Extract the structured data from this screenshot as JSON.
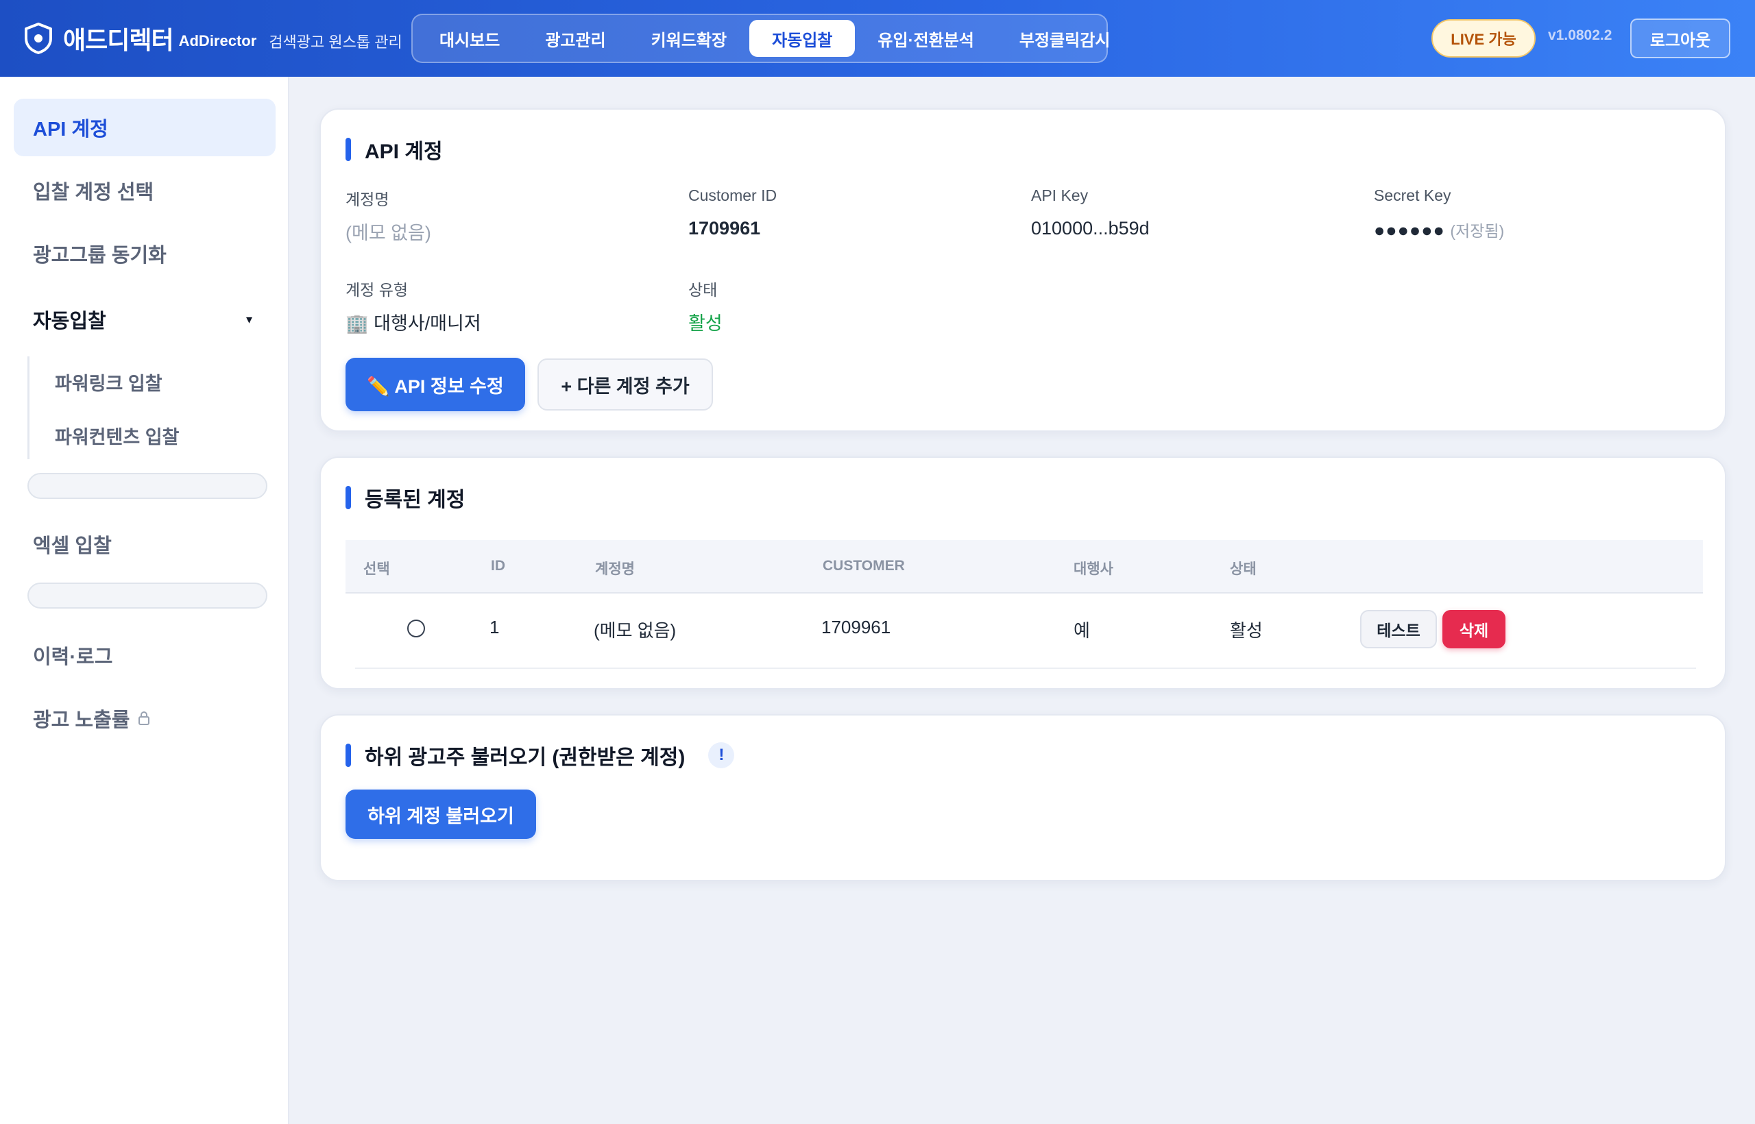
{
  "header": {
    "brand_kr": "애드디렉터",
    "brand_en": "AdDirector",
    "brand_sub": "검색광고 원스톱 관리",
    "tabs": [
      {
        "label": "대시보드",
        "active": false
      },
      {
        "label": "광고관리",
        "active": false
      },
      {
        "label": "키워드확장",
        "active": false
      },
      {
        "label": "자동입찰",
        "active": true
      },
      {
        "label": "유입·전환분석",
        "active": false
      },
      {
        "label": "부정클릭감시",
        "active": false
      }
    ],
    "live_badge": "LIVE 가능",
    "version": "v1.0802.2",
    "logout_label": "로그아웃"
  },
  "sidebar": {
    "api_account": "API 계정",
    "bid_account_select": "입찰 계정 선택",
    "adgroup_sync": "광고그룹 동기화",
    "auto_bid": "자동입찰",
    "auto_bid_caret": "▾",
    "powerlink_bid": "파워링크 입찰",
    "powercontents_bid": "파워컨텐츠 입찰",
    "excel_bid": "엑셀 입찰",
    "history_log": "이력·로그",
    "ad_exposure": "광고 노출률"
  },
  "api_card": {
    "title": "API 계정",
    "account_name_label": "계정명",
    "account_name_value": "(메모 없음)",
    "customer_id_label": "Customer ID",
    "customer_id_value": "1709961",
    "api_key_label": "API Key",
    "api_key_value": "010000...b59d",
    "secret_key_label": "Secret Key",
    "secret_key_dots": "●●●●●●",
    "secret_key_saved": "(저장됨)",
    "account_type_label": "계정 유형",
    "account_type_icon": "🏢",
    "account_type_value": "대행사/매니저",
    "status_label": "상태",
    "status_value": "활성",
    "edit_button": "✏️ API 정보 수정",
    "add_button": "+ 다른 계정 추가"
  },
  "registered_card": {
    "title": "등록된 계정",
    "columns": [
      "선택",
      "ID",
      "계정명",
      "CUSTOMER",
      "대행사",
      "상태"
    ],
    "rows": [
      {
        "id": "1",
        "name": "(메모 없음)",
        "customer": "1709961",
        "agency": "예",
        "status": "활성",
        "test_label": "테스트",
        "delete_label": "삭제"
      }
    ]
  },
  "sub_card": {
    "title": "하위 광고주 불러오기 (권한받은 계정)",
    "info_mark": "!",
    "load_button": "하위 계정 불러오기"
  },
  "colors": {
    "primary": "#2f6ee8",
    "header_start": "#1d4fc4",
    "header_end": "#3b82f6",
    "active_green": "#16a34a",
    "danger": "#e62b4f",
    "live_text": "#b45309"
  }
}
